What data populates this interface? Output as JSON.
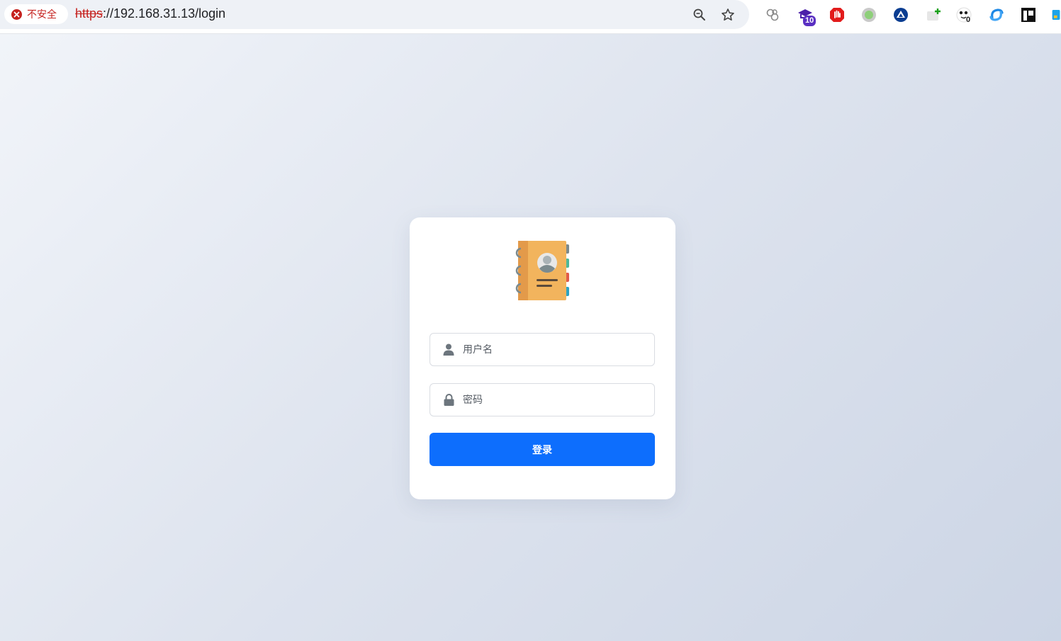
{
  "browser": {
    "security_label": "不安全",
    "url_scheme": "https",
    "url_rest": "://192.168.31.13/login",
    "extensions": [
      {
        "name": "link-extension-icon"
      },
      {
        "name": "graduation-cap-extension-icon",
        "badge": "10"
      },
      {
        "name": "hand-stop-extension-icon"
      },
      {
        "name": "green-dot-extension-icon"
      },
      {
        "name": "triangle-logo-extension-icon"
      },
      {
        "name": "add-tab-extension-icon"
      },
      {
        "name": "panda-extension-icon",
        "badge": "0"
      },
      {
        "name": "swirl-extension-icon"
      },
      {
        "name": "notion-extension-icon"
      },
      {
        "name": "partial-extension-icon"
      }
    ]
  },
  "login": {
    "username_placeholder": "用户名",
    "password_placeholder": "密码",
    "submit_label": "登录"
  },
  "colors": {
    "primary": "#0d6efd",
    "warning": "#c5221f",
    "notebook": "#f2b45d"
  }
}
